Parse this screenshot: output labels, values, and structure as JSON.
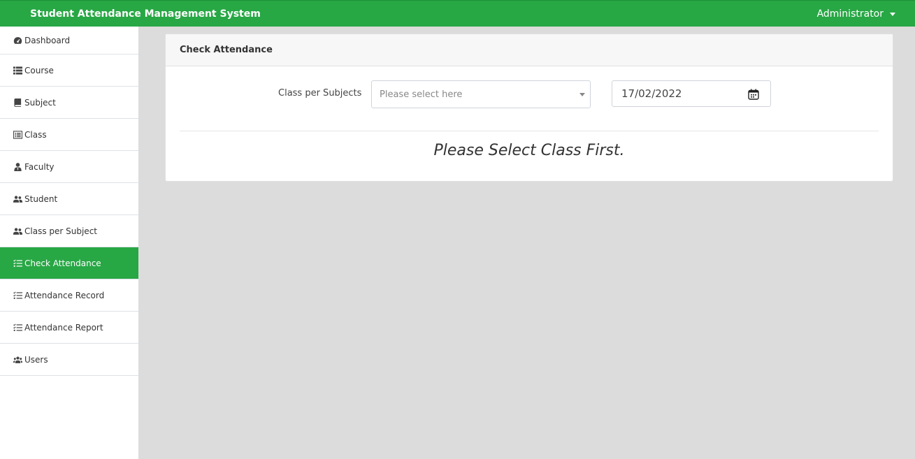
{
  "topbar": {
    "title": "Student Attendance Management System",
    "user": "Administrator"
  },
  "sidebar": {
    "items": [
      {
        "label": "Dashboard",
        "icon": "dashboard-icon"
      },
      {
        "label": "Course",
        "icon": "list-icon"
      },
      {
        "label": "Subject",
        "icon": "book-icon"
      },
      {
        "label": "Class",
        "icon": "list-alt-icon"
      },
      {
        "label": "Faculty",
        "icon": "user-tie-icon"
      },
      {
        "label": "Student",
        "icon": "user-friends-icon"
      },
      {
        "label": "Class per Subject",
        "icon": "user-friends-icon"
      },
      {
        "label": "Check Attendance",
        "icon": "tasks-icon",
        "active": true
      },
      {
        "label": "Attendance Record",
        "icon": "tasks-icon"
      },
      {
        "label": "Attendance Report",
        "icon": "tasks-icon"
      },
      {
        "label": "Users",
        "icon": "users-icon"
      }
    ]
  },
  "card": {
    "title": "Check Attendance",
    "class_label": "Class per Subjects",
    "class_placeholder": "Please select here",
    "date_value": "17/02/2022",
    "empty_message": "Please Select Class First."
  },
  "colors": {
    "brand": "#28a745",
    "background": "#dcdcdc"
  }
}
